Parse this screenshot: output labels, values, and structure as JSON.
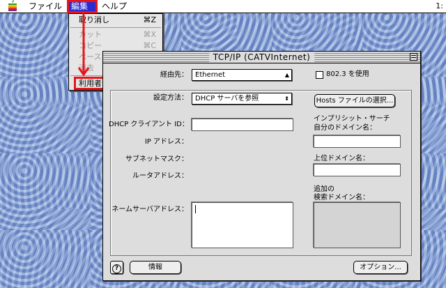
{
  "menubar": {
    "apple_icon": "apple-logo-icon",
    "file_label": "ファイル",
    "edit_label": "編集",
    "help_label": "ヘルプ",
    "clock": "1:"
  },
  "edit_menu": {
    "items": [
      {
        "label": "取り消し",
        "shortcut": "⌘Z",
        "enabled": true
      },
      {
        "label": "カット",
        "shortcut": "⌘X",
        "enabled": false
      },
      {
        "label": "コピー",
        "shortcut": "⌘C",
        "enabled": false
      },
      {
        "label": "ペースト",
        "shortcut": "⌘V",
        "enabled": false
      },
      {
        "label": "消去",
        "shortcut": "⌘B",
        "enabled": false
      },
      {
        "label": "利用者モード...",
        "shortcut": "⌘U",
        "enabled": true
      }
    ]
  },
  "window": {
    "title": "TCP/IP (CATVInternet)",
    "connect_via_label": "経由先：",
    "connect_via_value": "Ethernet",
    "use_8023_label": "802.3 を使用",
    "configure_label": "設定方法：",
    "configure_value": "DHCP サーバを参照",
    "hosts_button": "Hosts ファイルの選択...",
    "dhcp_client_id_label": "DHCP クライアント ID：",
    "ip_address_label": "IP アドレス：",
    "subnet_mask_label": "サブネットマスク：",
    "router_address_label": "ルータアドレス：",
    "name_server_label": "ネームサーバアドレス：",
    "implicit_search_label_1": "インプリシット・サーチ",
    "implicit_search_label_2": "自分のドメイン名：",
    "admin_domain_label": "上位ドメイン名：",
    "additional_search_label_1": "追加の",
    "additional_search_label_2": "検索ドメイン名：",
    "info_button": "情報",
    "options_button": "オプション...",
    "help_button": "?"
  },
  "colors": {
    "highlight_red": "#e8141c",
    "menu_select_blue": "#2b2bd0",
    "desktop": "#7f9fd8"
  }
}
